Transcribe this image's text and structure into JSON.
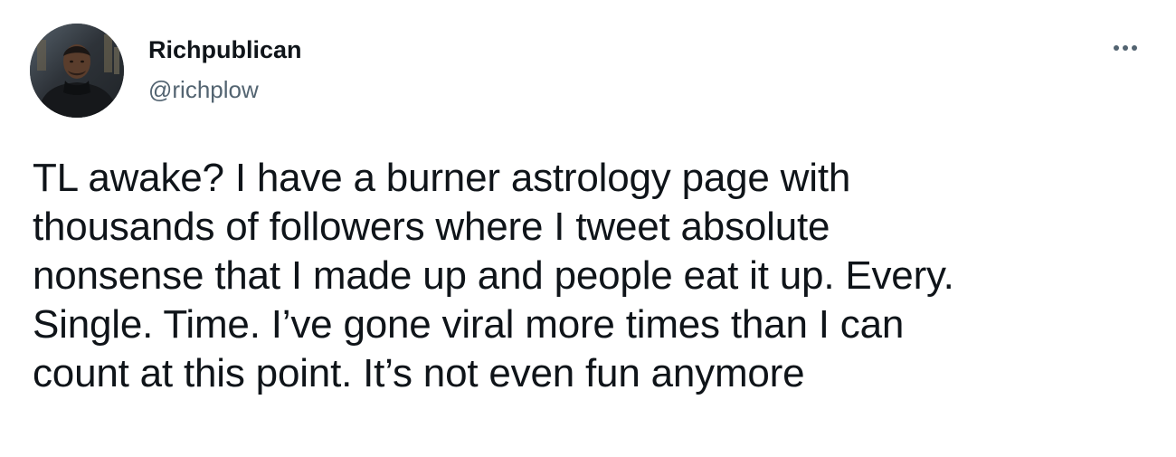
{
  "tweet": {
    "author": {
      "display_name": "Richpublican",
      "handle": "@richplow",
      "avatar_icon": "profile-photo"
    },
    "menu_icon": "more-horizontal-icon",
    "text": "TL awake? I have a burner astrology page with\nthousands of followers where I tweet absolute\nnonsense that I made up and people eat it up. Every.\nSingle. Time. I’ve gone viral more times than I can\ncount at this point. It’s not even fun anymore"
  },
  "colors": {
    "primary_text": "#0f1419",
    "secondary_text": "#536471",
    "background": "#ffffff"
  }
}
